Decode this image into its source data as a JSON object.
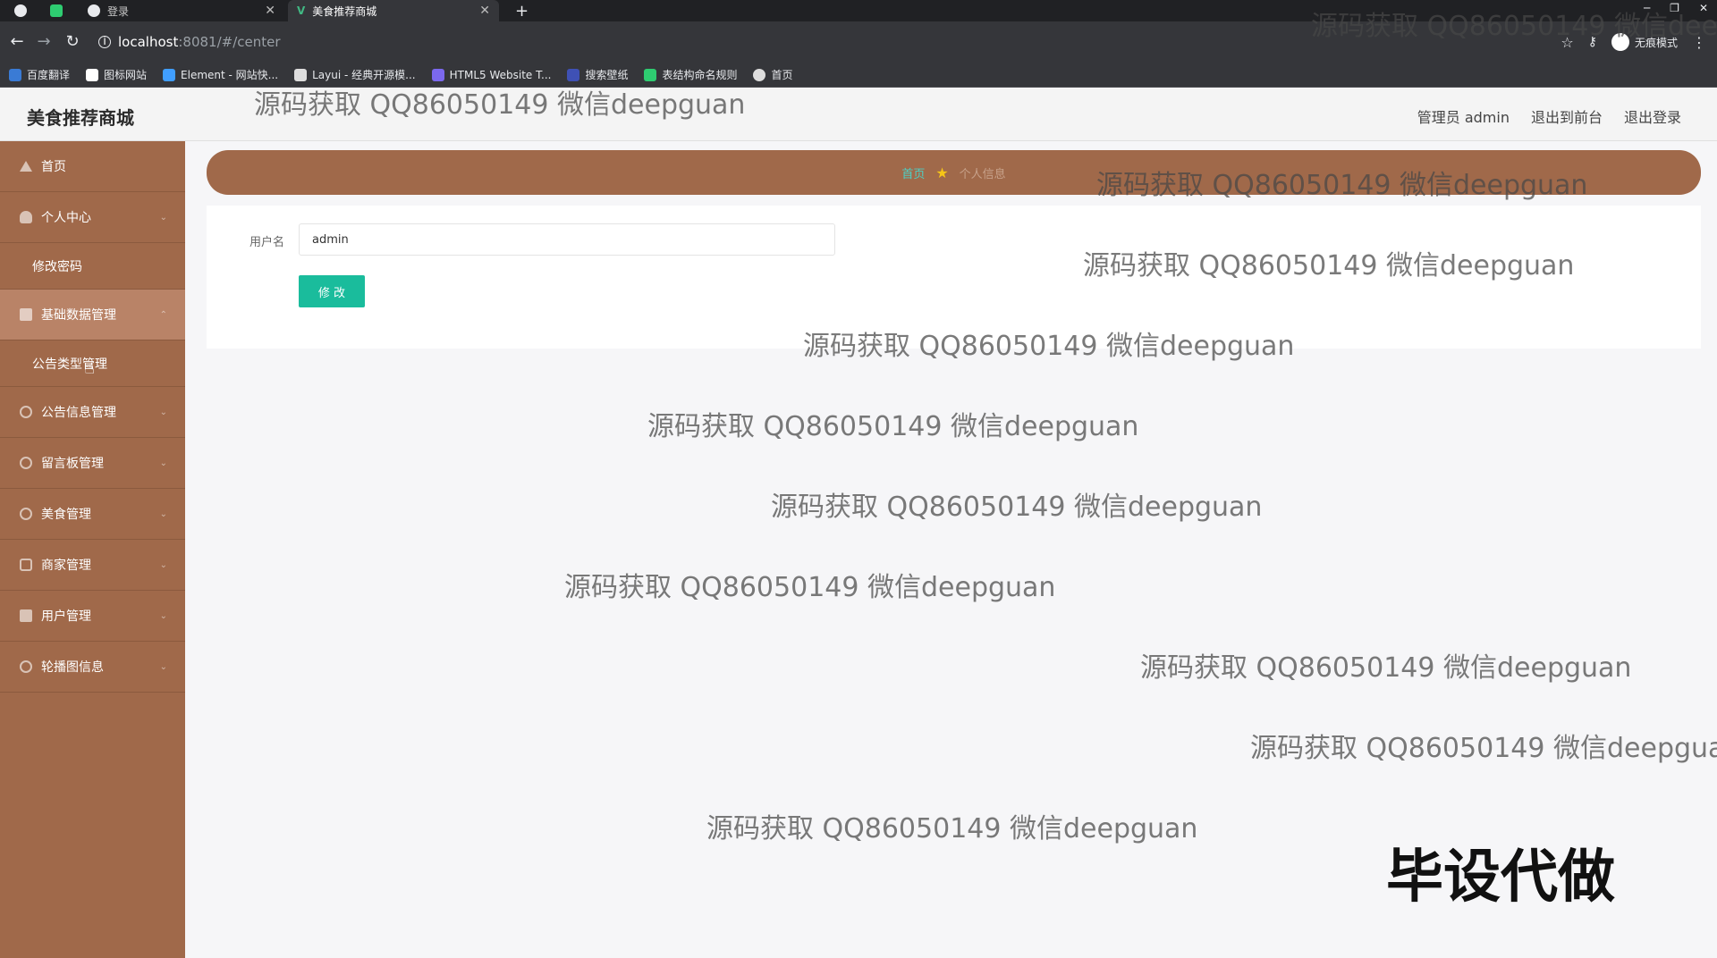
{
  "browser": {
    "tabs": [
      {
        "label": ""
      },
      {
        "label": ""
      },
      {
        "label": "登录"
      },
      {
        "label": "美食推荐商城"
      }
    ],
    "url_host": "localhost",
    "url_rest": ":8081/#/center",
    "incognito_label": "无痕模式",
    "bookmarks": [
      {
        "label": "百度翻译",
        "color": "#3a7bd5"
      },
      {
        "label": "图标网站",
        "color": "#ffffff"
      },
      {
        "label": "Element - 网站快...",
        "color": "#409eff"
      },
      {
        "label": "Layui - 经典开源模...",
        "color": "#dddddd"
      },
      {
        "label": "HTML5 Website T...",
        "color": "#7b68ee"
      },
      {
        "label": "搜索壁纸",
        "color": "#3f51b5"
      },
      {
        "label": "表结构命名规则",
        "color": "#2ecc71"
      },
      {
        "label": "首页",
        "color": "#dddddd"
      }
    ]
  },
  "header": {
    "title": "美食推荐商城",
    "user": "管理员 admin",
    "back_front": "退出到前台",
    "logout": "退出登录"
  },
  "sidebar": {
    "items": [
      {
        "label": "首页"
      },
      {
        "label": "个人中心"
      },
      {
        "label": "修改密码"
      },
      {
        "label": "基础数据管理"
      },
      {
        "label": "公告类型管理"
      },
      {
        "label": "公告信息管理"
      },
      {
        "label": "留言板管理"
      },
      {
        "label": "美食管理"
      },
      {
        "label": "商家管理"
      },
      {
        "label": "用户管理"
      },
      {
        "label": "轮播图信息"
      }
    ]
  },
  "breadcrumb": {
    "home": "首页",
    "current": "个人信息"
  },
  "form": {
    "username_label": "用户名",
    "username_value": "admin",
    "submit": "修 改"
  },
  "watermark": {
    "text": "源码获取 QQ86050149 微信deepguan",
    "stamp": "毕设代做"
  }
}
